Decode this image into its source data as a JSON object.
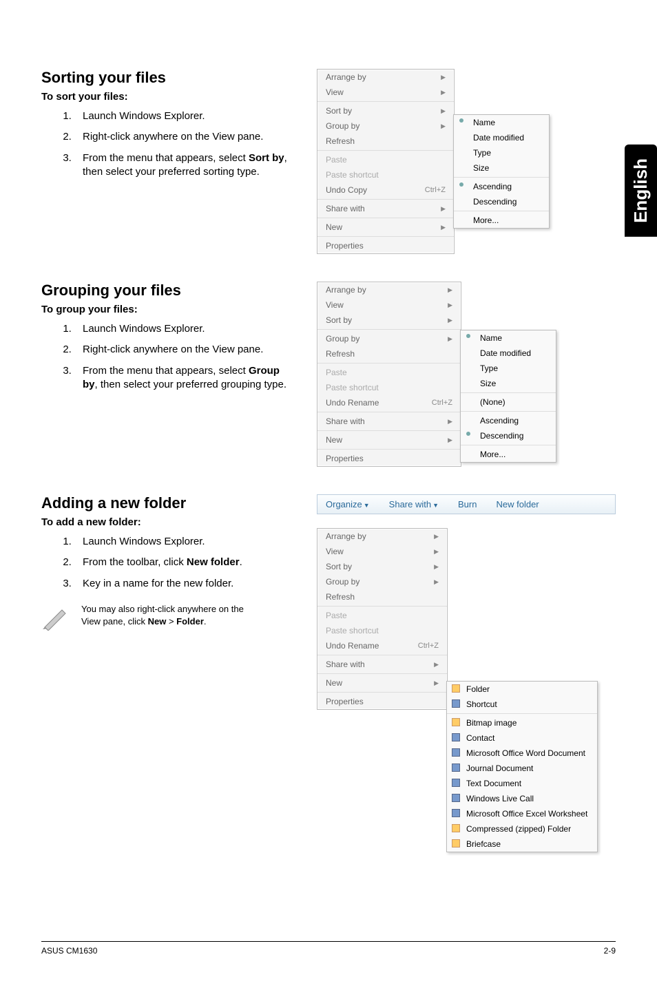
{
  "side_tab": "English",
  "sorting": {
    "heading": "Sorting your files",
    "sub": "To sort your files:",
    "steps": [
      "Launch Windows Explorer.",
      "Right-click anywhere on the View pane.",
      "From the menu that appears, select <b>Sort by</b>, then select your preferred sorting type."
    ],
    "menu": {
      "items": [
        {
          "label": "Arrange by",
          "arrow": true
        },
        {
          "label": "View",
          "arrow": true
        },
        {
          "sep": true
        },
        {
          "label": "Sort by",
          "arrow": true
        },
        {
          "label": "Group by",
          "arrow": true
        },
        {
          "label": "Refresh"
        },
        {
          "sep": true
        },
        {
          "label": "Paste",
          "disabled": true
        },
        {
          "label": "Paste shortcut",
          "disabled": true
        },
        {
          "label": "Undo Copy",
          "shortcut": "Ctrl+Z"
        },
        {
          "sep": true
        },
        {
          "label": "Share with",
          "arrow": true
        },
        {
          "sep": true
        },
        {
          "label": "New",
          "arrow": true
        },
        {
          "sep": true
        },
        {
          "label": "Properties"
        }
      ],
      "submenu": [
        {
          "label": "Name",
          "bullet": true
        },
        {
          "label": "Date modified"
        },
        {
          "label": "Type"
        },
        {
          "label": "Size"
        },
        {
          "sep": true
        },
        {
          "label": "Ascending",
          "bullet": true
        },
        {
          "label": "Descending"
        },
        {
          "sep": true
        },
        {
          "label": "More..."
        }
      ]
    }
  },
  "grouping": {
    "heading": "Grouping your files",
    "sub": "To group your files:",
    "steps": [
      "Launch Windows Explorer.",
      "Right-click anywhere on the View pane.",
      "From the menu that appears, select <b>Group by</b>, then select your preferred grouping type."
    ],
    "menu": {
      "items": [
        {
          "label": "Arrange by",
          "arrow": true
        },
        {
          "label": "View",
          "arrow": true
        },
        {
          "label": "Sort by",
          "arrow": true
        },
        {
          "sep": true
        },
        {
          "label": "Group by",
          "arrow": true
        },
        {
          "label": "Refresh"
        },
        {
          "sep": true
        },
        {
          "label": "Paste",
          "disabled": true
        },
        {
          "label": "Paste shortcut",
          "disabled": true
        },
        {
          "label": "Undo Rename",
          "shortcut": "Ctrl+Z"
        },
        {
          "sep": true
        },
        {
          "label": "Share with",
          "arrow": true
        },
        {
          "sep": true
        },
        {
          "label": "New",
          "arrow": true
        },
        {
          "sep": true
        },
        {
          "label": "Properties"
        }
      ],
      "submenu": [
        {
          "label": "Name",
          "bullet": true
        },
        {
          "label": "Date modified"
        },
        {
          "label": "Type"
        },
        {
          "label": "Size"
        },
        {
          "sep": true
        },
        {
          "label": "(None)"
        },
        {
          "sep": true
        },
        {
          "label": "Ascending"
        },
        {
          "label": "Descending",
          "bullet": true
        },
        {
          "sep": true
        },
        {
          "label": "More..."
        }
      ]
    }
  },
  "adding": {
    "heading": "Adding a new folder",
    "sub": "To add a new folder:",
    "steps": [
      "Launch Windows Explorer.",
      "From the toolbar, click <b>New folder</b>.",
      "Key in a name for the new folder."
    ],
    "toolbar": {
      "organize": "Organize",
      "share": "Share with",
      "burn": "Burn",
      "newfolder": "New folder"
    },
    "note": "You may also right-click anywhere on the View pane, click <b>New</b> > <b>Folder</b>.",
    "menu": {
      "items": [
        {
          "label": "Arrange by",
          "arrow": true
        },
        {
          "label": "View",
          "arrow": true
        },
        {
          "label": "Sort by",
          "arrow": true
        },
        {
          "label": "Group by",
          "arrow": true
        },
        {
          "label": "Refresh"
        },
        {
          "sep": true
        },
        {
          "label": "Paste",
          "disabled": true
        },
        {
          "label": "Paste shortcut",
          "disabled": true
        },
        {
          "label": "Undo Rename",
          "shortcut": "Ctrl+Z"
        },
        {
          "sep": true
        },
        {
          "label": "Share with",
          "arrow": true
        },
        {
          "sep": true
        },
        {
          "label": "New",
          "arrow": true
        },
        {
          "sep": true
        },
        {
          "label": "Properties"
        }
      ],
      "submenu": [
        {
          "label": "Folder",
          "icon": "sq"
        },
        {
          "label": "Shortcut",
          "icon": "sqb"
        },
        {
          "sep": true
        },
        {
          "label": "Bitmap image",
          "icon": "sq"
        },
        {
          "label": "Contact",
          "icon": "sqb"
        },
        {
          "label": "Microsoft Office Word Document",
          "icon": "sqb"
        },
        {
          "label": "Journal Document",
          "icon": "sqb"
        },
        {
          "label": "Text Document",
          "icon": "sqb"
        },
        {
          "label": "Windows Live Call",
          "icon": "sqb"
        },
        {
          "label": "Microsoft Office Excel Worksheet",
          "icon": "sqb"
        },
        {
          "label": "Compressed (zipped) Folder",
          "icon": "sq"
        },
        {
          "label": "Briefcase",
          "icon": "sq"
        }
      ]
    }
  },
  "footer": {
    "left": "ASUS CM1630",
    "right": "2-9"
  }
}
